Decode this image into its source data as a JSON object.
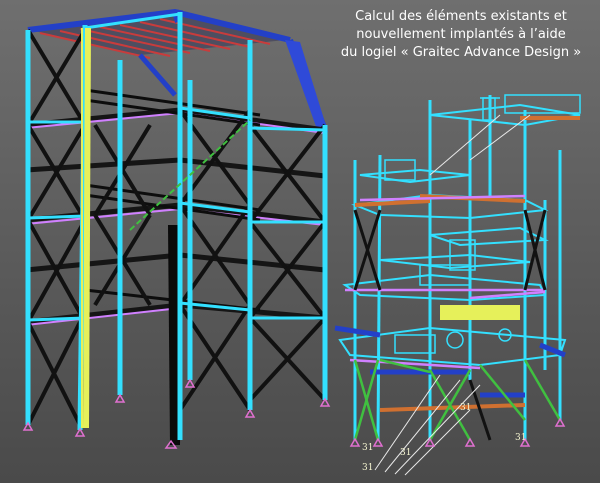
{
  "caption": {
    "line1": "Calcul des éléments existants et",
    "line2": "nouvellement implantés à l’aide",
    "line3": "du logiel « Graitec Advance Design »"
  },
  "node_labels": [
    "31",
    "31",
    "31",
    "31",
    "31"
  ],
  "colors": {
    "background": "#5e5e5e",
    "column_cyan": "#33e0ff",
    "bracing_black": "#111111",
    "beam_blue": "#2340c8",
    "purlin_red": "#c83c3c",
    "highlight_yellow": "#e6f05a",
    "beam_magenta": "#d080ff",
    "beam_green": "#40c040",
    "support_pink": "#e070d0",
    "beam_orange": "#d07030"
  }
}
